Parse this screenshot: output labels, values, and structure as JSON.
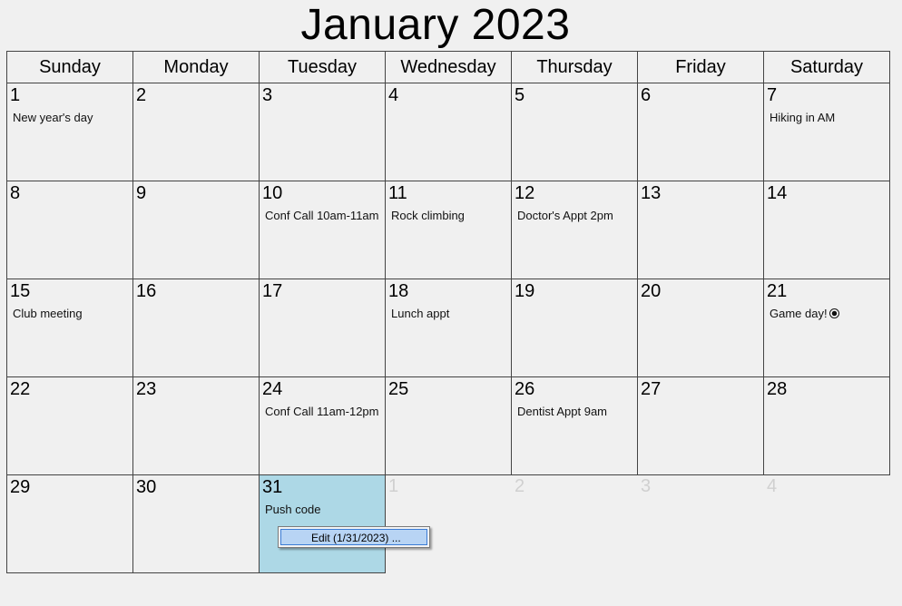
{
  "calendar": {
    "title": "January 2023",
    "weekdays": [
      "Sunday",
      "Monday",
      "Tuesday",
      "Wednesday",
      "Thursday",
      "Friday",
      "Saturday"
    ],
    "weeks": [
      [
        {
          "day": "1",
          "event": "New year's day"
        },
        {
          "day": "2",
          "event": ""
        },
        {
          "day": "3",
          "event": ""
        },
        {
          "day": "4",
          "event": ""
        },
        {
          "day": "5",
          "event": ""
        },
        {
          "day": "6",
          "event": ""
        },
        {
          "day": "7",
          "event": "Hiking in AM"
        }
      ],
      [
        {
          "day": "8",
          "event": ""
        },
        {
          "day": "9",
          "event": ""
        },
        {
          "day": "10",
          "event": "Conf Call 10am-11am"
        },
        {
          "day": "11",
          "event": "Rock climbing"
        },
        {
          "day": "12",
          "event": "Doctor's Appt 2pm"
        },
        {
          "day": "13",
          "event": ""
        },
        {
          "day": "14",
          "event": ""
        }
      ],
      [
        {
          "day": "15",
          "event": "Club meeting"
        },
        {
          "day": "16",
          "event": ""
        },
        {
          "day": "17",
          "event": ""
        },
        {
          "day": "18",
          "event": "Lunch appt"
        },
        {
          "day": "19",
          "event": ""
        },
        {
          "day": "20",
          "event": ""
        },
        {
          "day": "21",
          "event": "Game  day!",
          "icon": "soccer-ball-icon"
        }
      ],
      [
        {
          "day": "22",
          "event": ""
        },
        {
          "day": "23",
          "event": ""
        },
        {
          "day": "24",
          "event": "Conf Call 11am-12pm"
        },
        {
          "day": "25",
          "event": ""
        },
        {
          "day": "26",
          "event": "Dentist Appt 9am"
        },
        {
          "day": "27",
          "event": ""
        },
        {
          "day": "28",
          "event": ""
        }
      ],
      [
        {
          "day": "29",
          "event": ""
        },
        {
          "day": "30",
          "event": ""
        },
        {
          "day": "31",
          "event": "Push code",
          "selected": true
        },
        {
          "day": "1",
          "event": "",
          "other_month": true
        },
        {
          "day": "2",
          "event": "",
          "other_month": true
        },
        {
          "day": "3",
          "event": "",
          "other_month": true
        },
        {
          "day": "4",
          "event": "",
          "other_month": true
        }
      ]
    ]
  },
  "context_menu": {
    "edit_label": "Edit (1/31/2023) ..."
  },
  "colors": {
    "background": "#f0f0f0",
    "selected_day": "#add8e6",
    "grid_lines": "#444444",
    "other_month_text": "#d0d0d0",
    "menu_highlight": "#b8d4f4"
  }
}
